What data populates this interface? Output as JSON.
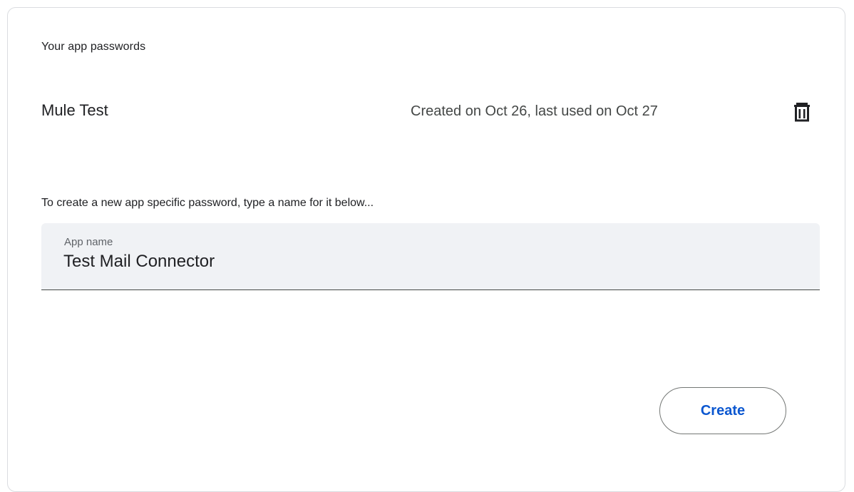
{
  "section": {
    "title": "Your app passwords"
  },
  "passwords": [
    {
      "name": "Mule Test",
      "meta": "Created on Oct 26, last used on Oct 27",
      "delete_icon": "trash-icon"
    }
  ],
  "create_form": {
    "instruction": "To create a new app specific password, type a name for it below...",
    "field_label": "App name",
    "field_value": "Test Mail Connector",
    "create_label": "Create"
  },
  "colors": {
    "accent": "#0b57d0",
    "text": "#202124",
    "muted": "#444746",
    "field_bg": "#f0f2f5",
    "border": "#dadce0"
  }
}
